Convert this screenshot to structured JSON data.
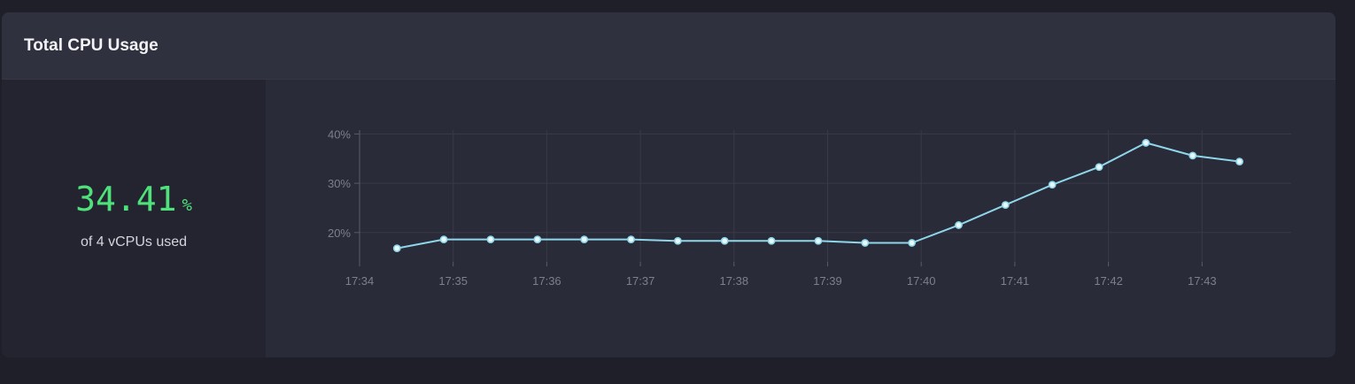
{
  "panel": {
    "title": "Total CPU Usage"
  },
  "stat": {
    "value": "34.41",
    "unit": "%",
    "caption": "of 4 vCPUs used"
  },
  "colors": {
    "accent_value": "#4fe27b",
    "line": "#8fd6ea"
  },
  "chart_data": {
    "type": "line",
    "title": "",
    "xlabel": "",
    "ylabel": "",
    "grid": true,
    "x_ticks": [
      "17:34",
      "17:35",
      "17:36",
      "17:37",
      "17:38",
      "17:39",
      "17:40",
      "17:41",
      "17:42",
      "17:43"
    ],
    "y_ticks": [
      "20%",
      "30%",
      "40%"
    ],
    "x": [
      "17:34:24",
      "17:34:54",
      "17:35:24",
      "17:35:54",
      "17:36:24",
      "17:36:54",
      "17:37:24",
      "17:37:54",
      "17:38:24",
      "17:38:54",
      "17:39:24",
      "17:39:54",
      "17:40:24",
      "17:40:54",
      "17:41:24",
      "17:41:54",
      "17:42:24",
      "17:42:54",
      "17:43:24"
    ],
    "series": [
      {
        "values": [
          16.8,
          18.6,
          18.6,
          18.6,
          18.6,
          18.6,
          18.3,
          18.3,
          18.3,
          18.3,
          17.9,
          17.9,
          21.5,
          25.6,
          29.7,
          33.3,
          38.2,
          35.6,
          34.4
        ]
      }
    ]
  }
}
